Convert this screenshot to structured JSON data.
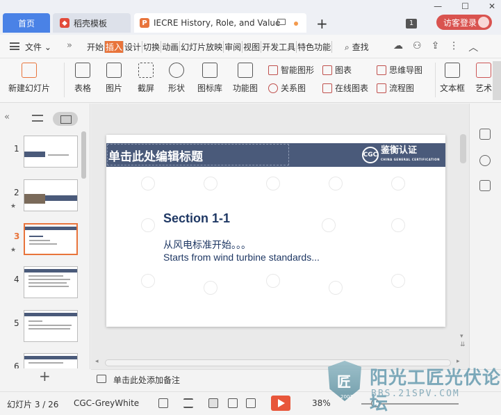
{
  "tabs": [
    {
      "label": "首页"
    },
    {
      "label": "稻壳模板"
    },
    {
      "label": "IECRE History, Role, and Value"
    }
  ],
  "titlebar": {
    "badge": "1",
    "login_label": "访客登录"
  },
  "menu": {
    "file_label": "文件",
    "tabs": [
      "开始",
      "插入",
      "设计",
      "切换",
      "动画",
      "幻灯片放映",
      "审阅",
      "视图",
      "开发工具",
      "特色功能"
    ],
    "active_tab": "插入",
    "search_label": "查找"
  },
  "ribbon": {
    "new_slide": "新建幻灯片",
    "table": "表格",
    "picture": "图片",
    "screenshot": "截屏",
    "shape": "形状",
    "icon_lib": "图标库",
    "func_chart": "功能图",
    "smart_shape": "智能图形",
    "chart": "图表",
    "relation": "关系图",
    "online_chart": "在线图表",
    "mindmap": "思维导图",
    "flowchart": "流程图",
    "textbox": "文本框",
    "art": "艺术"
  },
  "thumbnails": [
    {
      "num": "1"
    },
    {
      "num": "2"
    },
    {
      "num": "3"
    },
    {
      "num": "4"
    },
    {
      "num": "5"
    },
    {
      "num": "6"
    }
  ],
  "slide": {
    "title_placeholder": "单击此处编辑标题",
    "logo_text": "鉴衡认证",
    "logo_mark": "CGC",
    "logo_sub": "CHINA GENERAL CERTIFICATION",
    "section": "Section 1-1",
    "line_zh": "从风电标准开始。。。",
    "line_en": "Starts from wind turbine standards..."
  },
  "notes": {
    "placeholder": "单击此处添加备注"
  },
  "status": {
    "slide_count": "幻灯片 3 / 26",
    "theme": "CGC-GreyWhite",
    "zoom": "38%"
  },
  "forum": {
    "name": "阳光工匠光伏论坛",
    "url": "BBS.21SPV.COM",
    "year": "2007",
    "mark": "匠"
  },
  "colors": {
    "accent": "#e8743b",
    "home_tab": "#4a82e6",
    "slide_band": "#4a5a7a",
    "slide_text": "#1f3864",
    "login": "#d9534f"
  }
}
